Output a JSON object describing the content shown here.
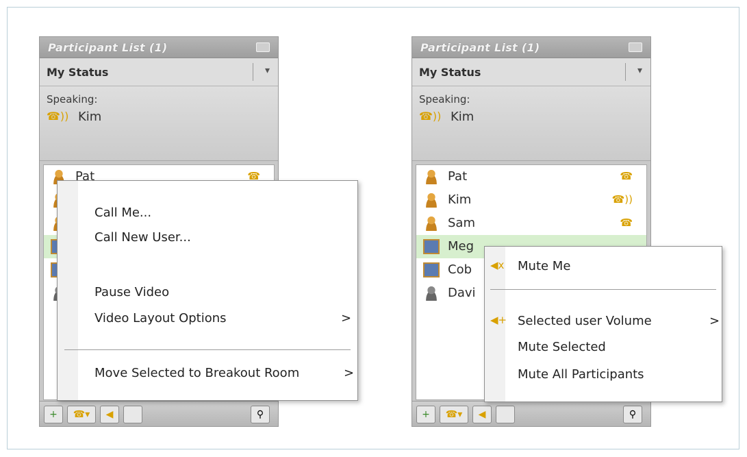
{
  "left_panel": {
    "title": "Participant List (1)",
    "status_label": "My Status",
    "dropdown_glyph": "▾",
    "speaking_label": "Speaking:",
    "speaking_name": "Kim",
    "participants": [
      {
        "name": "Pat",
        "avatar": "person-icon"
      },
      {
        "name": "",
        "avatar": "person-icon"
      },
      {
        "name": "",
        "avatar": "person-icon"
      },
      {
        "name": "",
        "avatar": "screen-icon"
      },
      {
        "name": "",
        "avatar": "screen-icon"
      },
      {
        "name": "",
        "avatar": "grey-person-icon"
      }
    ],
    "context_menu": [
      {
        "label": "Call Me...",
        "arrow": ""
      },
      {
        "label": "Call New User...",
        "arrow": ""
      },
      {
        "label": "Pause Video",
        "arrow": ""
      },
      {
        "label": "Video Layout Options",
        "arrow": ">"
      },
      {
        "label": "Move Selected to Breakout Room",
        "arrow": ">"
      }
    ]
  },
  "right_panel": {
    "title": "Participant List (1)",
    "status_label": "My Status",
    "dropdown_glyph": "▾",
    "speaking_label": "Speaking:",
    "speaking_name": "Kim",
    "participants": [
      {
        "name": "Pat",
        "avatar": "person-icon"
      },
      {
        "name": "Kim",
        "avatar": "person-icon"
      },
      {
        "name": "Sam",
        "avatar": "person-icon"
      },
      {
        "name": "Meg",
        "avatar": "screen-icon"
      },
      {
        "name": "Cob",
        "avatar": "screen-icon"
      },
      {
        "name": "Davi",
        "avatar": "grey-person-icon"
      }
    ],
    "context_menu": [
      {
        "label": "Mute Me",
        "arrow": ""
      },
      {
        "label": "Selected user Volume",
        "arrow": ">"
      },
      {
        "label": "Mute Selected",
        "arrow": ""
      },
      {
        "label": "Mute All Participants",
        "arrow": ""
      }
    ]
  },
  "colors": {
    "accent": "#d9a100",
    "selected_row": "#d7efce"
  }
}
